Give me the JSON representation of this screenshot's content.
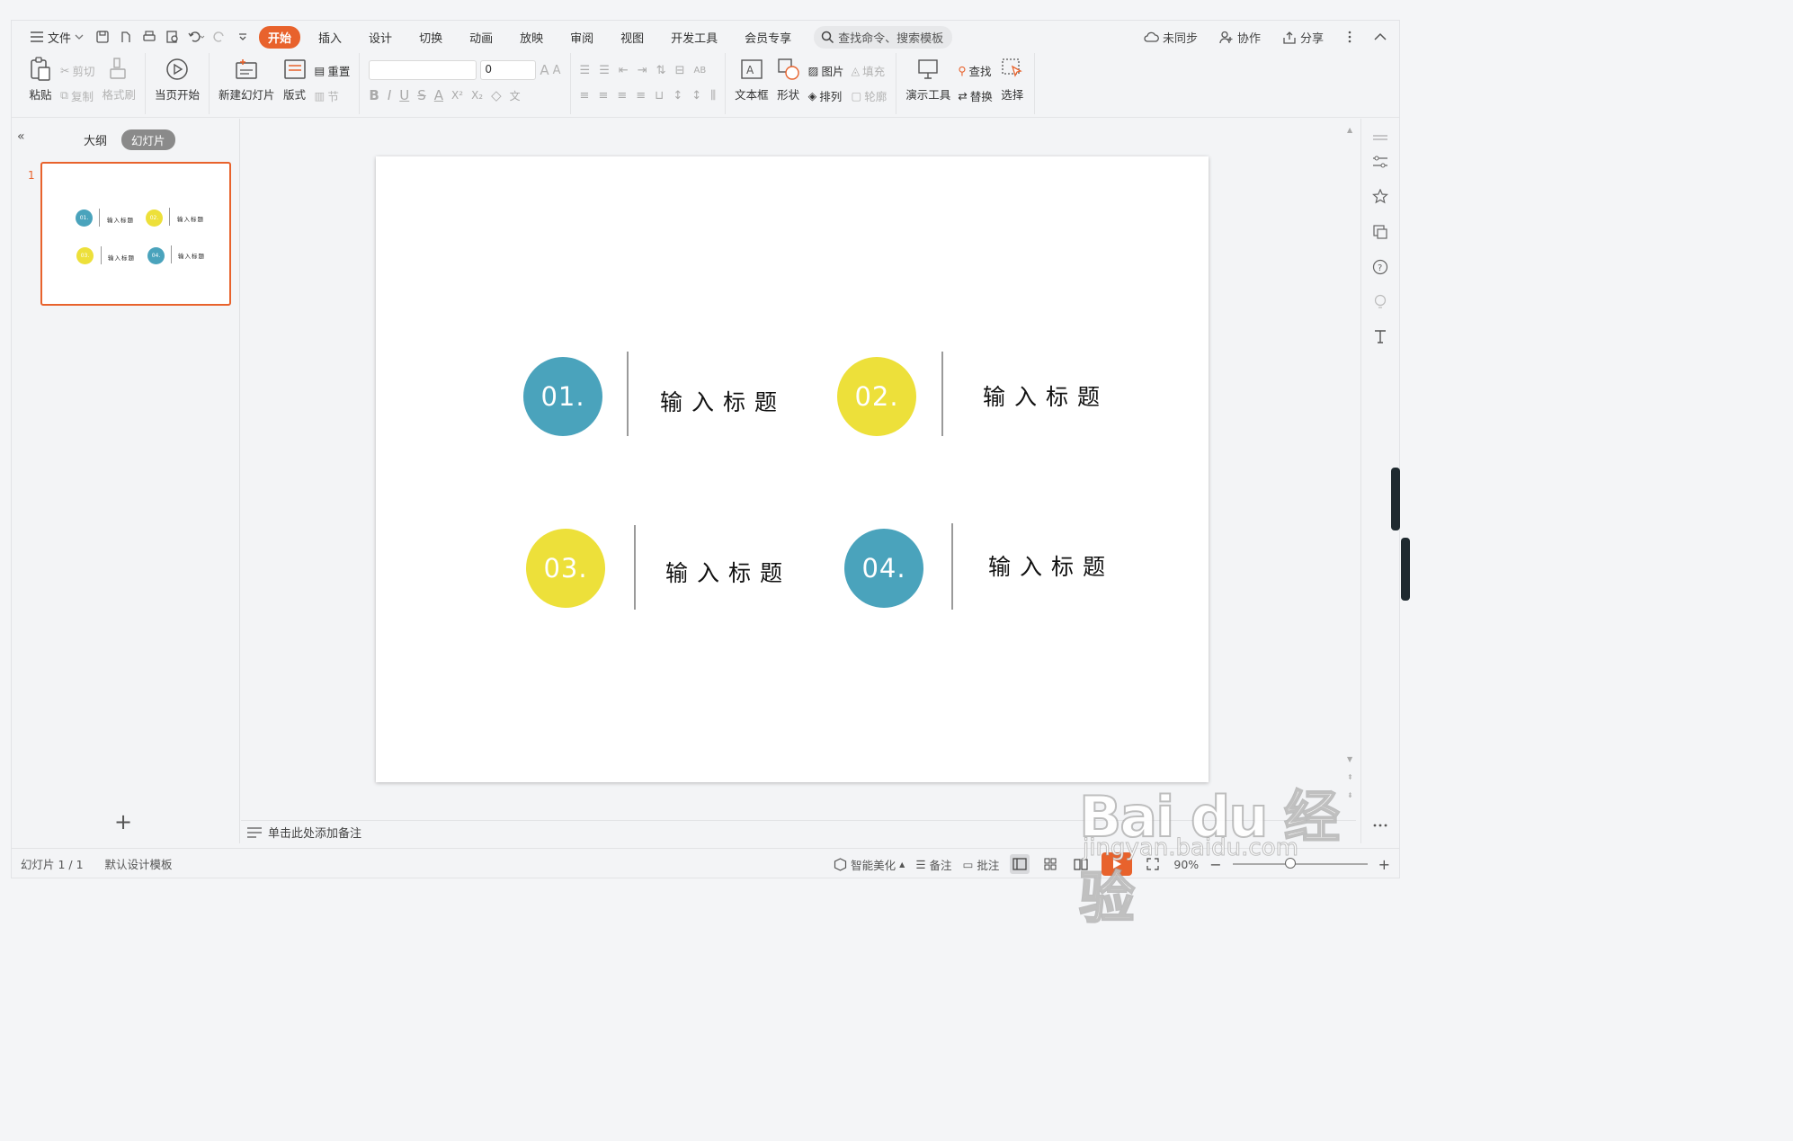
{
  "menubar": {
    "file_label": "文件",
    "tabs": [
      "开始",
      "插入",
      "设计",
      "切换",
      "动画",
      "放映",
      "审阅",
      "视图",
      "开发工具",
      "会员专享"
    ],
    "active_tab": "开始",
    "search_placeholder": "查找命令、搜索模板",
    "right": {
      "sync": "未同步",
      "collab": "协作",
      "share": "分享"
    }
  },
  "ribbon": {
    "paste": "粘贴",
    "cut": "剪切",
    "copy": "复制",
    "format_painter": "格式刷",
    "play_current": "当页开始",
    "new_slide": "新建幻灯片",
    "layout": "版式",
    "reset": "重置",
    "section": "节",
    "font_size": "0",
    "textbox": "文本框",
    "shape": "形状",
    "picture": "图片",
    "arrange": "排列",
    "fill": "填充",
    "outline": "轮廓",
    "present_tools": "演示工具",
    "find": "查找",
    "replace": "替换",
    "select": "选择"
  },
  "leftpanel": {
    "tab_outline": "大纲",
    "tab_slides": "幻灯片",
    "slide_number": "1",
    "add_icon": "+"
  },
  "slide": {
    "items": [
      {
        "num": "01.",
        "title": "输入标题",
        "color": "#4aa3bc"
      },
      {
        "num": "02.",
        "title": "输入标题",
        "color": "#ede03a"
      },
      {
        "num": "03.",
        "title": "输入标题",
        "color": "#ede03a"
      },
      {
        "num": "04.",
        "title": "输入标题",
        "color": "#4aa3bc"
      }
    ]
  },
  "notes": {
    "placeholder": "单击此处添加备注"
  },
  "statusbar": {
    "slide_info": "幻灯片 1 / 1",
    "template": "默认设计模板",
    "beautify": "智能美化",
    "notes": "备注",
    "comments": "批注",
    "zoom": "90%"
  },
  "colors": {
    "accent": "#e8622c",
    "teal": "#4aa3bc",
    "yellow": "#ede03a"
  },
  "watermark": {
    "main": "Bai du 经验",
    "sub": "jingyan.baidu.com"
  }
}
